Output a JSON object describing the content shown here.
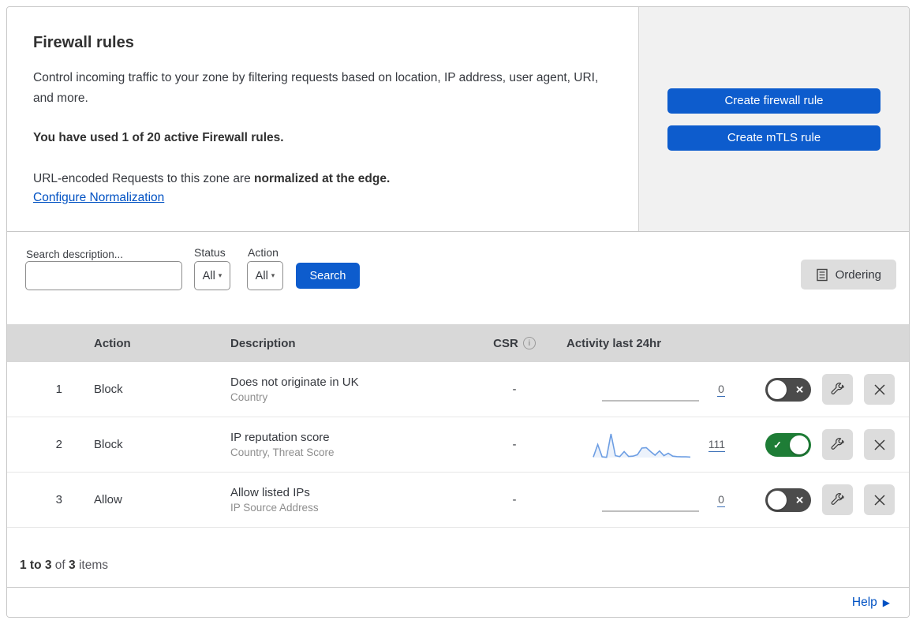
{
  "intro": {
    "title": "Firewall rules",
    "description": "Control incoming traffic to your zone by filtering requests based on location, IP address, user agent, URI, and more.",
    "usage": "You have used 1 of 20 active Firewall rules.",
    "normalization_prefix": "URL-encoded Requests to this zone are ",
    "normalization_bold": "normalized at the edge.",
    "normalization_link": "Configure Normalization"
  },
  "actions": {
    "create_firewall_label": "Create firewall rule",
    "create_mtls_label": "Create mTLS rule"
  },
  "filters": {
    "search_label": "Search description...",
    "search_value": "",
    "status_label": "Status",
    "status_value": "All",
    "action_label": "Action",
    "action_value": "All",
    "search_button": "Search",
    "ordering_button": "Ordering"
  },
  "table": {
    "headers": {
      "action": "Action",
      "description": "Description",
      "csr": "CSR",
      "activity": "Activity last 24hr"
    },
    "rows": [
      {
        "num": "1",
        "action": "Block",
        "description": "Does not originate in UK",
        "criteria": "Country",
        "csr": "-",
        "count": "0",
        "enabled": false,
        "sparkline": []
      },
      {
        "num": "2",
        "action": "Block",
        "description": "IP reputation score",
        "criteria": "Country, Threat Score",
        "csr": "-",
        "count": "111",
        "enabled": true,
        "sparkline": [
          2,
          55,
          3,
          1,
          100,
          8,
          4,
          25,
          5,
          6,
          12,
          40,
          42,
          25,
          10,
          28,
          8,
          18,
          6,
          4,
          3,
          3,
          2
        ]
      },
      {
        "num": "3",
        "action": "Allow",
        "description": "Allow listed IPs",
        "criteria": "IP Source Address",
        "csr": "-",
        "count": "0",
        "enabled": false,
        "sparkline": []
      }
    ]
  },
  "footer": {
    "pagination_bold1": "1 to 3",
    "pagination_mid": " of ",
    "pagination_bold2": "3",
    "pagination_suffix": " items",
    "help_label": "Help"
  },
  "icons": {
    "toggle_on_mark": "✓",
    "toggle_off_mark": "✕",
    "dropdown_caret": "▾",
    "help_arrow": "▶",
    "info_glyph": "i"
  },
  "colors": {
    "primary_blue": "#0d5ccd",
    "link_blue": "#0051c3",
    "toggle_green": "#1e7d36",
    "toggle_gray": "#4b4b4b",
    "sparkline_blue": "#6d9ee3",
    "header_gray": "#d8d8d8",
    "panel_gray": "#f1f1f1"
  }
}
